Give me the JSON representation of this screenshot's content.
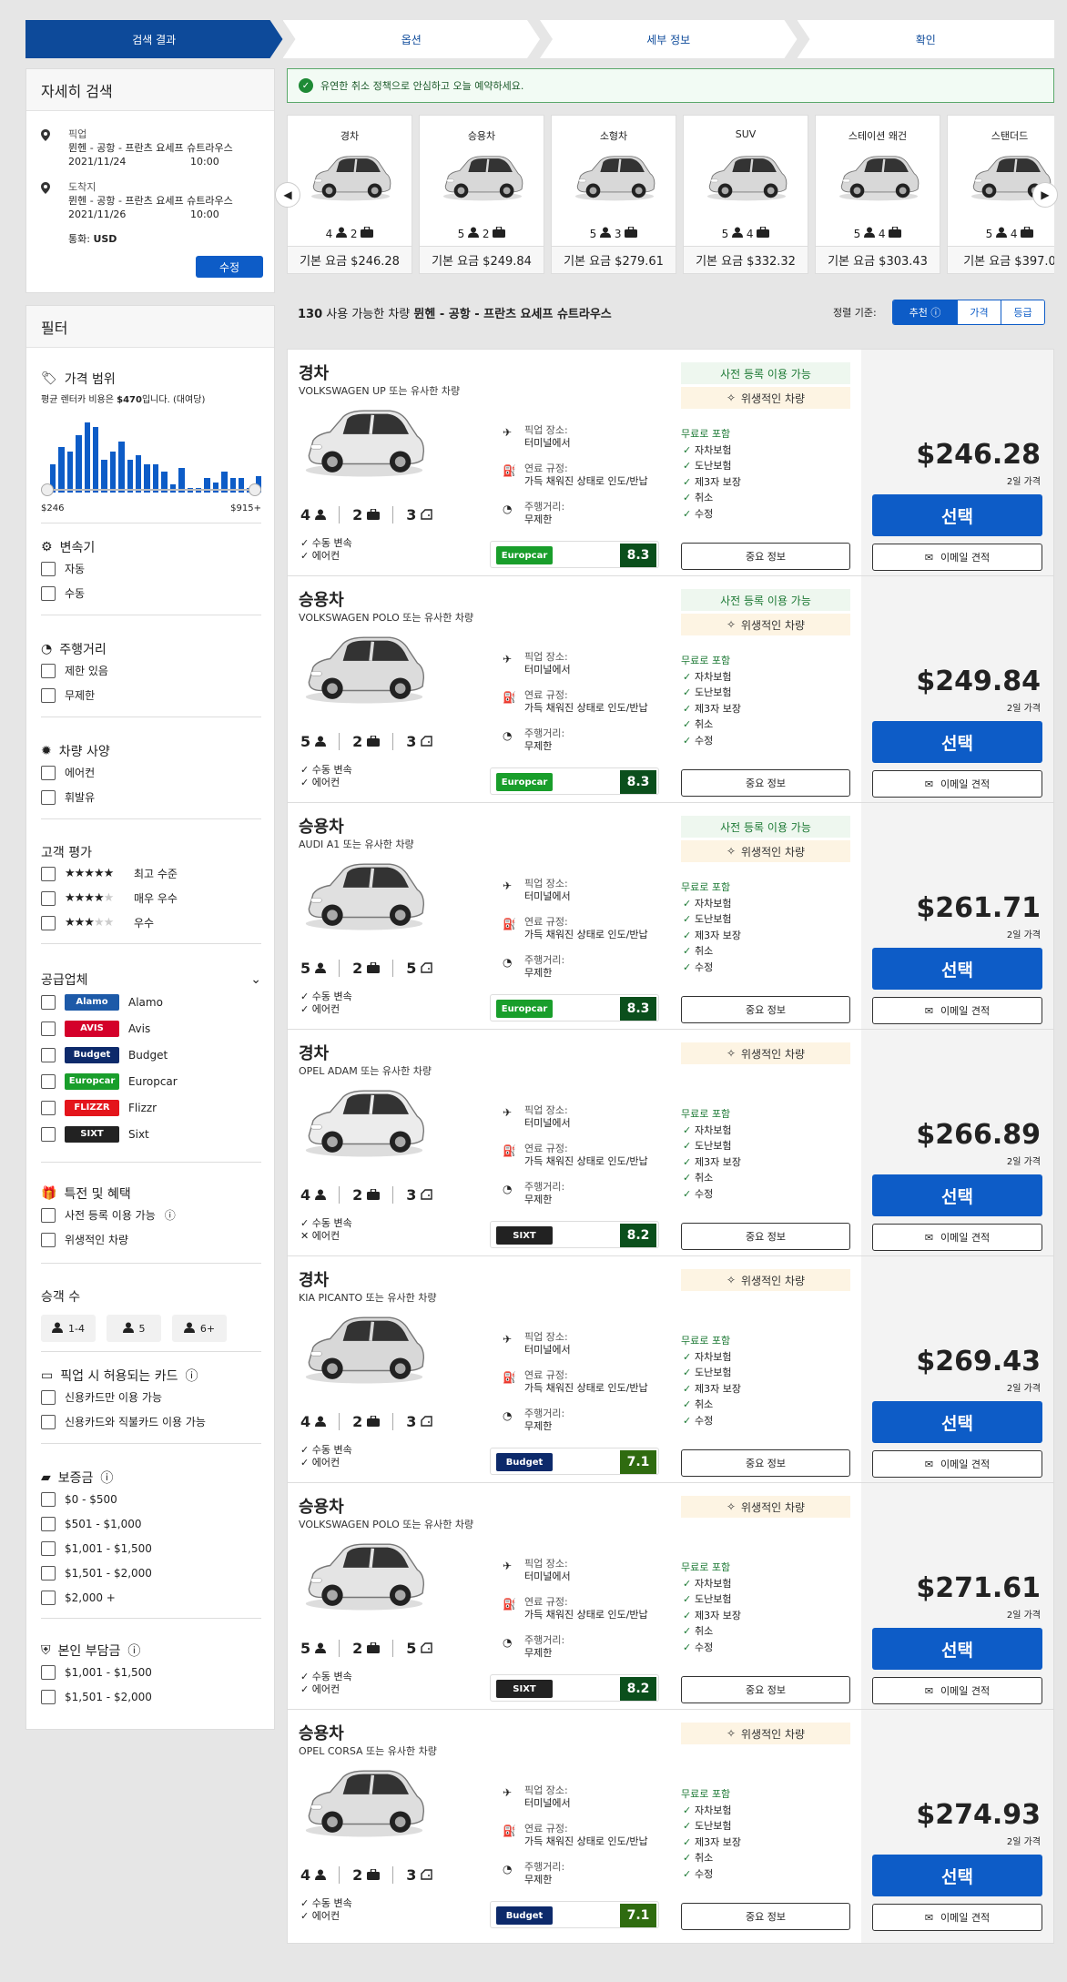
{
  "steps": [
    "검색 결과",
    "옵션",
    "세부 정보",
    "확인"
  ],
  "notice": "유연한 취소 정책으로 안심하고 오늘 예약하세요.",
  "search": {
    "title": "자세히 검색",
    "pickup_label": "픽업",
    "pickup_place": "뮌헨 - 공항 - 프란츠 요세프 슈트라우스",
    "pickup_date": "2021/11/24",
    "pickup_time": "10:00",
    "dropoff_label": "도착지",
    "dropoff_place": "뮌헨 - 공항 - 프란츠 요세프 슈트라우스",
    "dropoff_date": "2021/11/26",
    "dropoff_time": "10:00",
    "currency_label": "통화:",
    "currency": "USD",
    "edit": "수정"
  },
  "filters": {
    "title": "필터",
    "price": {
      "title": "가격 범위",
      "note_pre": "평균 렌터카 비용은 ",
      "note_amount": "$470",
      "note_post": "입니다. (대여당)",
      "min": "$246",
      "max": "$915+",
      "hist": [
        0.35,
        0.55,
        0.5,
        0.7,
        0.85,
        0.8,
        0.4,
        0.5,
        0.62,
        0.4,
        0.45,
        0.35,
        0.35,
        0.25,
        0.1,
        0.3,
        0.05,
        0.05,
        0.18,
        0.12,
        0.25,
        0.18,
        0.18,
        0.05,
        0.2
      ]
    },
    "transmission": {
      "title": "변속기",
      "options": [
        "자동",
        "수동"
      ]
    },
    "mileage": {
      "title": "주행거리",
      "options": [
        "제한 있음",
        "무제한"
      ]
    },
    "specs": {
      "title": "차량 사양",
      "options": [
        "에어컨",
        "휘발유"
      ]
    },
    "rating": {
      "title": "고객 평가",
      "options": [
        {
          "stars": 5,
          "label": "최고 수준"
        },
        {
          "stars": 4,
          "label": "매우 우수"
        },
        {
          "stars": 3,
          "label": "우수"
        }
      ]
    },
    "suppliers": {
      "title": "공급업체",
      "items": [
        {
          "name": "Alamo",
          "logo": "Alamo",
          "bg": "#1d5aa8"
        },
        {
          "name": "Avis",
          "logo": "AVIS",
          "bg": "#d4002a"
        },
        {
          "name": "Budget",
          "logo": "Budget",
          "bg": "#0d2a6b"
        },
        {
          "name": "Europcar",
          "logo": "Europcar",
          "bg": "#199e2b"
        },
        {
          "name": "Flizzr",
          "logo": "FLIZZR",
          "bg": "#e4151b"
        },
        {
          "name": "Sixt",
          "logo": "SIXT",
          "bg": "#222222"
        }
      ]
    },
    "perks": {
      "title": "특전 및 혜택",
      "options": [
        "사전 등록 이용 가능",
        "위생적인 차량"
      ]
    },
    "passengers": {
      "title": "승객 수",
      "options": [
        "1-4",
        "5",
        "6+"
      ]
    },
    "cards": {
      "title": "픽업 시 허용되는 카드",
      "options": [
        "신용카드만 이용 가능",
        "신용카드와 직불카드 이용 가능"
      ]
    },
    "deposit": {
      "title": "보증금",
      "options": [
        "$0 - $500",
        "$501 - $1,000",
        "$1,001 - $1,500",
        "$1,501 - $2,000",
        "$2,000 +"
      ]
    },
    "excess": {
      "title": "본인 부담금",
      "options": [
        "$1,001 - $1,500",
        "$1,501 - $2,000"
      ]
    }
  },
  "categories": [
    {
      "name": "경차",
      "pax": "4",
      "bags": "2",
      "price": "기본 요금 $246.28"
    },
    {
      "name": "승용차",
      "pax": "5",
      "bags": "2",
      "price": "기본 요금 $249.84"
    },
    {
      "name": "소형차",
      "pax": "5",
      "bags": "3",
      "price": "기본 요금 $279.61"
    },
    {
      "name": "SUV",
      "pax": "5",
      "bags": "4",
      "price": "기본 요금 $332.32"
    },
    {
      "name": "스테이션 왜건",
      "pax": "5",
      "bags": "4",
      "price": "기본 요금 $303.43"
    },
    {
      "name": "스탠더드",
      "pax": "5",
      "bags": "4",
      "price": "기본 요금 $397.0"
    }
  ],
  "results": {
    "count": "130",
    "count_text": "사용 가능한 차량",
    "location": "뮌헨 - 공항 - 프란츠 요세프 슈트라우스",
    "sort_label": "정렬 기준:",
    "sort_options": [
      "추천",
      "가격",
      "등급"
    ]
  },
  "labels": {
    "pickup_loc": "픽업 장소:",
    "terminal": "터미널에서",
    "fuel": "연료 규정:",
    "fuel_val": "가득 채워진 상태로 인도/반납",
    "mileage": "주행거리:",
    "mileage_val": "무제한",
    "free": "무료로 포함",
    "incl": [
      "자차보험",
      "도난보험",
      "제3자 보장",
      "취소",
      "수정"
    ],
    "info": "중요 정보",
    "select": "선택",
    "email": "이메일 견적",
    "price_tag": "2일 가격",
    "man": "수동 변속",
    "ac": "에어컨",
    "prereg": "사전 등록 이용 가능",
    "hygiene": "위생적인 차량"
  },
  "cars": [
    {
      "cls": "경차",
      "model": "VOLKSWAGEN UP 또는 유사한 차량",
      "pax": "4",
      "bags": "2",
      "doors": "3",
      "ac": true,
      "prereg": true,
      "vendor": "Europcar",
      "vbg": "#199e2b",
      "score": "8.3",
      "scol": "#0b4f1c",
      "price": "$246.28",
      "color": "#e8e8e8"
    },
    {
      "cls": "승용차",
      "model": "VOLKSWAGEN POLO 또는 유사한 차량",
      "pax": "5",
      "bags": "2",
      "doors": "3",
      "ac": true,
      "prereg": true,
      "vendor": "Europcar",
      "vbg": "#199e2b",
      "score": "8.3",
      "scol": "#0b4f1c",
      "price": "$249.84",
      "color": "#dcdcdc"
    },
    {
      "cls": "승용차",
      "model": "AUDI A1 또는 유사한 차량",
      "pax": "5",
      "bags": "2",
      "doors": "5",
      "ac": true,
      "prereg": true,
      "vendor": "Europcar",
      "vbg": "#199e2b",
      "score": "8.3",
      "scol": "#0b4f1c",
      "price": "$261.71",
      "color": "#e0e0e0"
    },
    {
      "cls": "경차",
      "model": "OPEL ADAM 또는 유사한 차량",
      "pax": "4",
      "bags": "2",
      "doors": "3",
      "ac": false,
      "prereg": false,
      "vendor": "SIXT",
      "vbg": "#222222",
      "score": "8.2",
      "scol": "#0b4f1c",
      "price": "$266.89",
      "color": "#ececec"
    },
    {
      "cls": "경차",
      "model": "KIA PICANTO 또는 유사한 차량",
      "pax": "4",
      "bags": "2",
      "doors": "3",
      "ac": true,
      "prereg": false,
      "vendor": "Budget",
      "vbg": "#0d2a6b",
      "score": "7.1",
      "scol": "#2f6b10",
      "price": "$269.43",
      "color": "#d8d8d8"
    },
    {
      "cls": "승용차",
      "model": "VOLKSWAGEN POLO 또는 유사한 차량",
      "pax": "5",
      "bags": "2",
      "doors": "5",
      "ac": true,
      "prereg": false,
      "vendor": "SIXT",
      "vbg": "#222222",
      "score": "8.2",
      "scol": "#0b4f1c",
      "price": "$271.61",
      "color": "#e4e4e4"
    },
    {
      "cls": "승용차",
      "model": "OPEL CORSA 또는 유사한 차량",
      "pax": "4",
      "bags": "2",
      "doors": "3",
      "ac": true,
      "prereg": false,
      "vendor": "Budget",
      "vbg": "#0d2a6b",
      "score": "7.1",
      "scol": "#2f6b10",
      "price": "$274.93",
      "color": "#dedede"
    }
  ]
}
